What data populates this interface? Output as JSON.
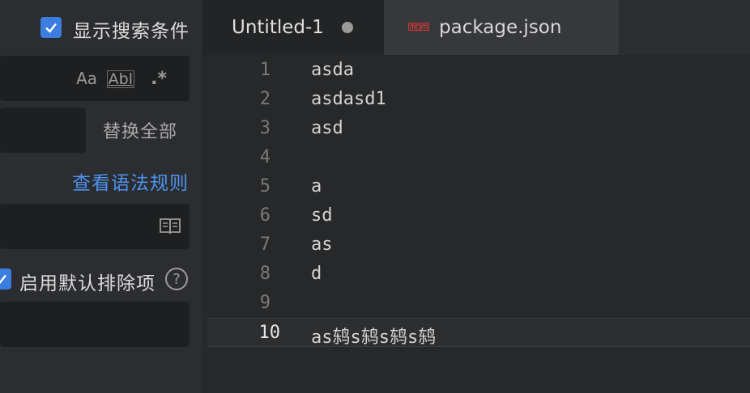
{
  "search_panel": {
    "show_conditions_label": "显示搜索条件",
    "options": {
      "match_case": "Aa",
      "whole_word": "Abl",
      "regex": ".*"
    },
    "replace_all": "替换全部",
    "syntax_link": "查看语法规则",
    "use_default_excludes_label": "启用默认排除项",
    "help": "?"
  },
  "tabs": [
    {
      "label": "Untitled-1",
      "active": true,
      "dirty": true
    },
    {
      "label": "package.json",
      "active": false,
      "icon": "npm-icon"
    }
  ],
  "editor": {
    "current_line": 10,
    "lines": [
      {
        "num": "1",
        "text": "asda"
      },
      {
        "num": "2",
        "text": "asdasd1"
      },
      {
        "num": "3",
        "text": "asd"
      },
      {
        "num": "4",
        "text": ""
      },
      {
        "num": "5",
        "text": "a"
      },
      {
        "num": "6",
        "text": "sd"
      },
      {
        "num": "7",
        "text": "as"
      },
      {
        "num": "8",
        "text": "d"
      },
      {
        "num": "9",
        "text": ""
      },
      {
        "num": "10",
        "text": "as鸫s鸫s鸫s鸫"
      }
    ]
  },
  "colors": {
    "accent": "#3b7ee0",
    "link": "#4d93f0",
    "npm": "#cb3837"
  }
}
